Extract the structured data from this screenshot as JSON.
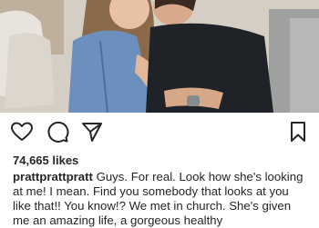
{
  "post": {
    "image_alt": "Photo of a couple sitting on a couch",
    "likes": "74,665 likes",
    "username": "prattprattpratt",
    "caption": "Guys. For real. Look how she's looking at me! I mean. Find you somebody that looks at you like that!! You know!? We met in church. She's given me an amazing life, a gorgeous healthy"
  },
  "actions": {
    "like_icon": "heart-icon",
    "comment_icon": "comment-icon",
    "share_icon": "send-icon",
    "save_icon": "bookmark-icon"
  }
}
